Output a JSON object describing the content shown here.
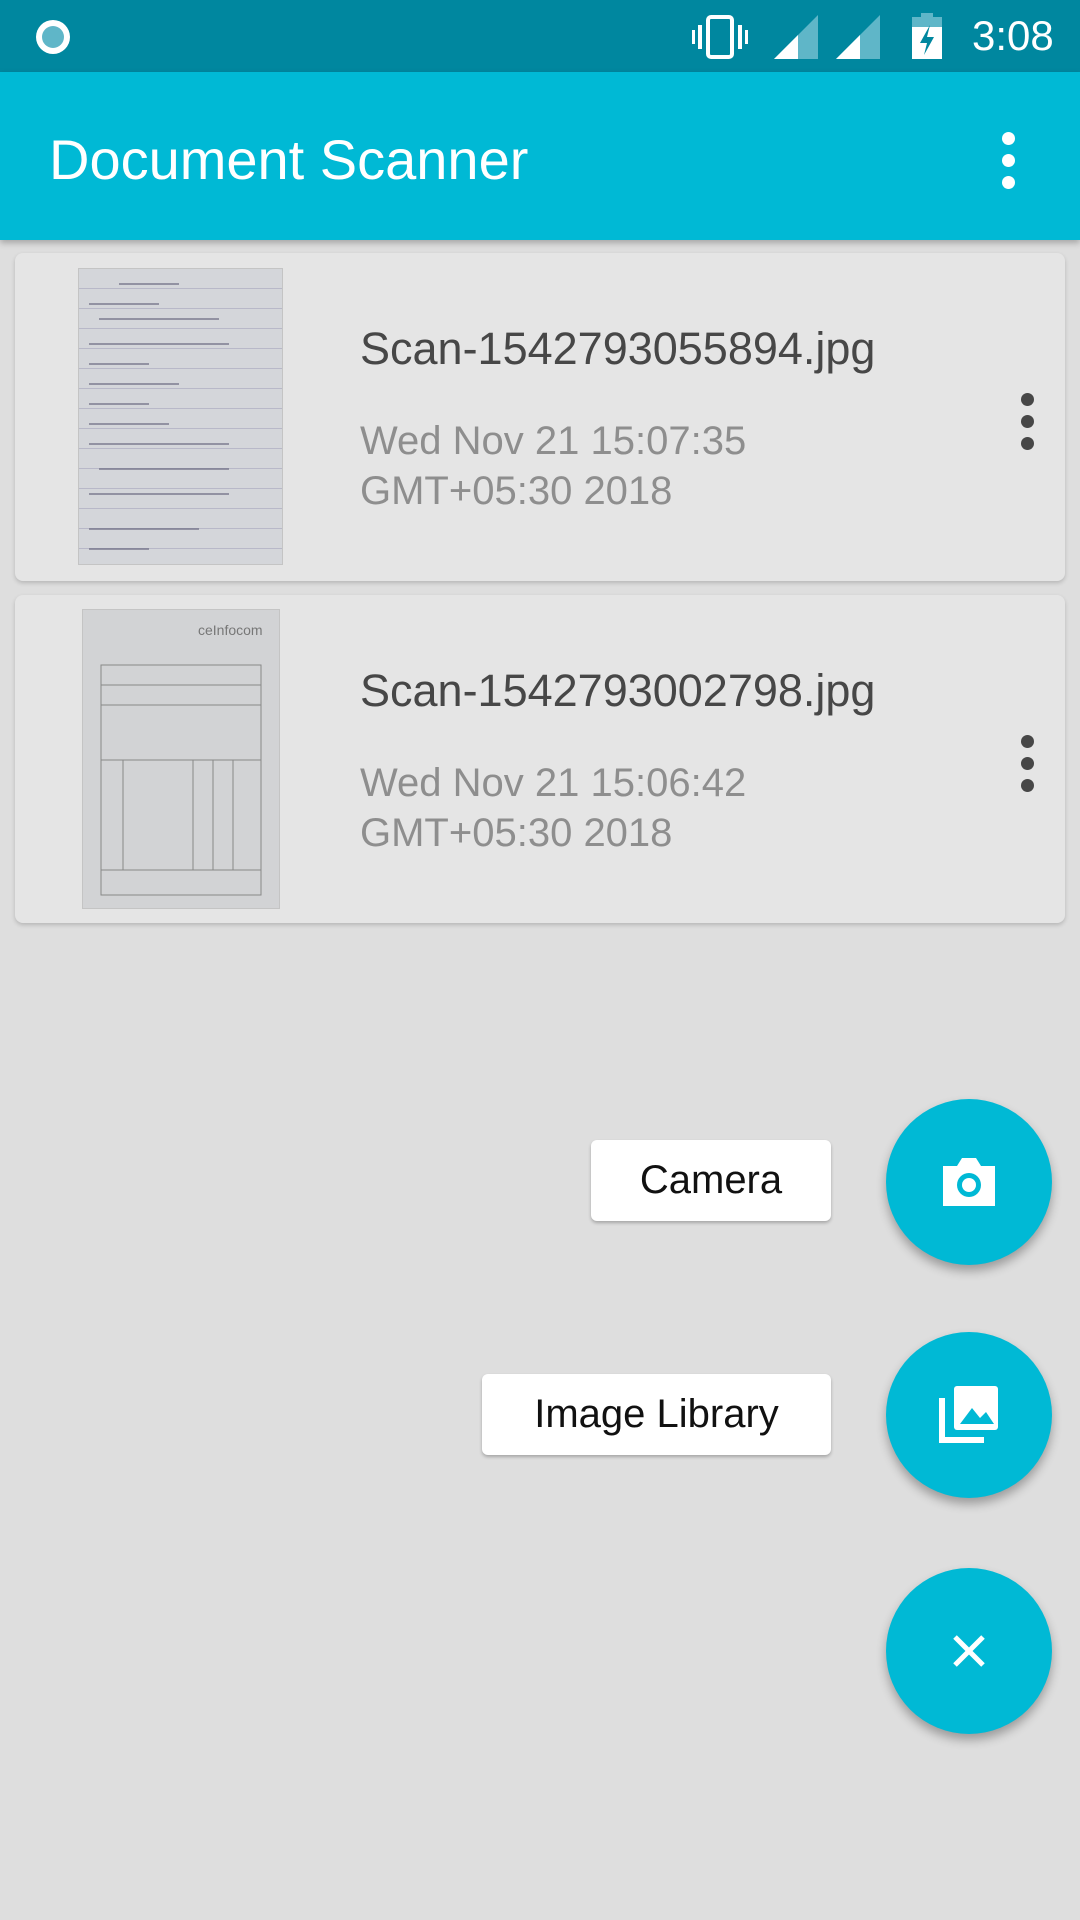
{
  "status_bar": {
    "time": "3:08",
    "icons": [
      "app-notification-icon",
      "vibrate-icon",
      "signal-icon",
      "signal-icon",
      "battery-charging-icon"
    ]
  },
  "app_bar": {
    "title": "Document Scanner",
    "menu_icon": "more-vert-icon"
  },
  "scans": [
    {
      "file_name": "Scan-1542793055894.jpg",
      "date_line1": "Wed Nov 21 15:07:35",
      "date_line2": "GMT+05:30 2018"
    },
    {
      "file_name": "Scan-1542793002798.jpg",
      "date_line1": "Wed Nov 21 15:06:42",
      "date_line2": "GMT+05:30 2018"
    }
  ],
  "thumbnail_text": "ceInfocom",
  "fab_menu": {
    "camera_label": "Camera",
    "library_label": "Image Library",
    "accent": "#00b9d5"
  }
}
